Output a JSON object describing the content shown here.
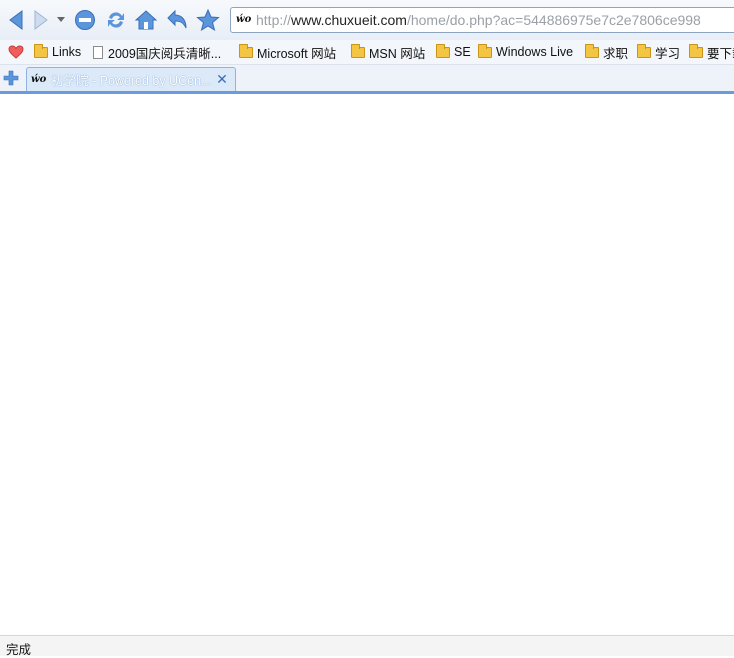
{
  "toolbar": {
    "icons": [
      "back-icon",
      "forward-icon",
      "dropdown-icon",
      "stop-icon",
      "refresh-icon",
      "home-icon",
      "undo-close-icon",
      "favorite-star-icon"
    ],
    "address": {
      "site_icon_text": "ẃo",
      "scheme": "http://",
      "host": "www.chuxueit.com",
      "path": "/home/do.php?ac=544886975e7c2e7806ce998"
    }
  },
  "bookmarks": {
    "items": [
      {
        "label": "Links",
        "icon": "folder-icon"
      },
      {
        "label": "2009国庆阅兵清晰...",
        "icon": "page-icon"
      },
      {
        "label": "Microsoft 网站",
        "icon": "folder-icon"
      },
      {
        "label": "MSN 网站",
        "icon": "folder-icon"
      },
      {
        "label": "SE",
        "icon": "folder-icon"
      },
      {
        "label": "Windows Live",
        "icon": "folder-icon"
      },
      {
        "label": "求职",
        "icon": "folder-icon"
      },
      {
        "label": "学习",
        "icon": "folder-icon"
      },
      {
        "label": "要下载",
        "icon": "folder-icon"
      }
    ]
  },
  "tabs": [
    {
      "title": "初学院 - Powered by UCen...",
      "site_icon_text": "ẃo",
      "active": true
    }
  ],
  "status": {
    "text": "完成"
  },
  "colors": {
    "accent": "#6b9bdc",
    "nav_icon": "#4f8ad6",
    "folder": "#f4c542"
  }
}
